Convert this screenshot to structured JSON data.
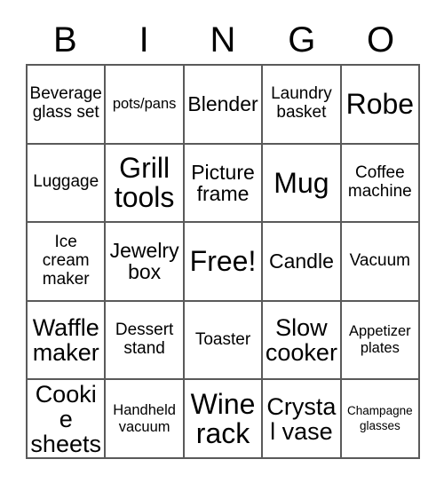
{
  "card": {
    "header_letters": [
      "B",
      "I",
      "N",
      "G",
      "O"
    ],
    "rows": [
      [
        {
          "label": "Beverage glass set",
          "size": "fs-m",
          "free": false
        },
        {
          "label": "pots/pans",
          "size": "fs-s",
          "free": false
        },
        {
          "label": "Blender",
          "size": "fs-l",
          "free": false
        },
        {
          "label": "Laundry basket",
          "size": "fs-m",
          "free": false
        },
        {
          "label": "Robe",
          "size": "fs-xxl",
          "free": false
        }
      ],
      [
        {
          "label": "Luggage",
          "size": "fs-m",
          "free": false
        },
        {
          "label": "Grill tools",
          "size": "fs-xxl",
          "free": false
        },
        {
          "label": "Picture frame",
          "size": "fs-l",
          "free": false
        },
        {
          "label": "Mug",
          "size": "fs-xxl",
          "free": false
        },
        {
          "label": "Coffee machine",
          "size": "fs-m",
          "free": false
        }
      ],
      [
        {
          "label": "Ice cream maker",
          "size": "fs-m",
          "free": false
        },
        {
          "label": "Jewelry box",
          "size": "fs-l",
          "free": false
        },
        {
          "label": "Free!",
          "size": "fs-xxl",
          "free": true
        },
        {
          "label": "Candle",
          "size": "fs-l",
          "free": false
        },
        {
          "label": "Vacuum",
          "size": "fs-m",
          "free": false
        }
      ],
      [
        {
          "label": "Waffle maker",
          "size": "fs-xl",
          "free": false
        },
        {
          "label": "Dessert stand",
          "size": "fs-m",
          "free": false
        },
        {
          "label": "Toaster",
          "size": "fs-m",
          "free": false
        },
        {
          "label": "Slow cooker",
          "size": "fs-xl",
          "free": false
        },
        {
          "label": "Appetizer plates",
          "size": "fs-s",
          "free": false
        }
      ],
      [
        {
          "label": "Cookie sheets",
          "size": "fs-xl",
          "free": false
        },
        {
          "label": "Handheld vacuum",
          "size": "fs-s",
          "free": false
        },
        {
          "label": "Wine rack",
          "size": "fs-xxl",
          "free": false
        },
        {
          "label": "Crystal vase",
          "size": "fs-xl",
          "free": false
        },
        {
          "label": "Champagne glasses",
          "size": "fs-xs",
          "free": false
        }
      ]
    ],
    "colors": {
      "background": "#ffffff",
      "text": "#000000",
      "grid_line": "#5a5a5a"
    }
  }
}
